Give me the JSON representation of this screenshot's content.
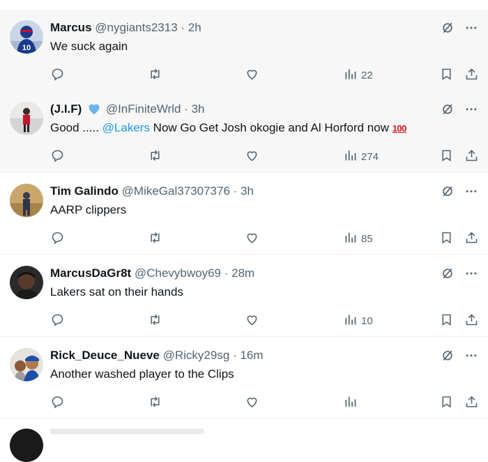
{
  "tweets": [
    {
      "name": "Marcus",
      "handle": "@nygiants2313",
      "sep": "·",
      "time": "2h",
      "text": "We suck again",
      "views": "22",
      "shaded": true
    },
    {
      "name": "(J.I.F)",
      "handle": "@InFiniteWrld",
      "sep": "·",
      "time": "3h",
      "text_before": "Good ..... ",
      "mention": "@Lakers",
      "text_after": " Now Go Get Josh okogie and Al Horford now ",
      "emoji": "100",
      "views": "274",
      "verified": true,
      "shaded": true
    },
    {
      "name": "Tim Galindo",
      "handle": "@MikeGal37307376",
      "sep": "·",
      "time": "3h",
      "text": "AARP clippers",
      "views": "85",
      "shaded": false
    },
    {
      "name": "MarcusDaGr8t",
      "handle": "@Chevybwoy69",
      "sep": "·",
      "time": "28m",
      "text": "Lakers sat on their hands",
      "views": "10",
      "shaded": false
    },
    {
      "name": "Rick_Deuce_Nueve",
      "handle": "@Ricky29sg",
      "sep": "·",
      "time": "16m",
      "text": "Another washed player to the Clips",
      "views": "",
      "shaded": false
    }
  ],
  "icons": {
    "reply": "reply-icon",
    "retweet": "retweet-icon",
    "like": "like-icon",
    "views": "views-icon",
    "bookmark": "bookmark-icon",
    "share": "share-icon",
    "grok": "grok-icon",
    "more": "more-icon"
  },
  "colors": {
    "text": "#0f1419",
    "secondary": "#536471",
    "link": "#1d9bf0",
    "verified": "#6cb4ee",
    "shaded_bg": "#f7f7f7"
  }
}
